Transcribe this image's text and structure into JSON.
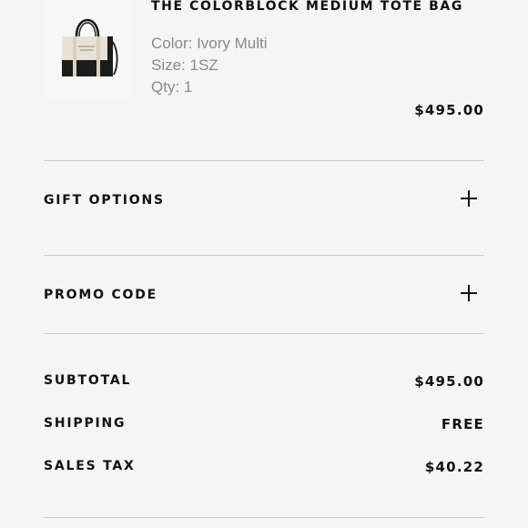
{
  "line_item": {
    "title": "THE COLORBLOCK MEDIUM TOTE BAG",
    "color": "Color: Ivory Multi",
    "size": "Size: 1SZ",
    "qty": "Qty: 1",
    "price": "$495.00",
    "image_icon": "tote-bag-image"
  },
  "accordions": {
    "gift_options": {
      "label": "GIFT OPTIONS",
      "icon": "plus-icon"
    },
    "promo_code": {
      "label": "PROMO CODE",
      "icon": "plus-icon"
    }
  },
  "summary": {
    "subtotal": {
      "label": "SUBTOTAL",
      "value": "$495.00"
    },
    "shipping": {
      "label": "SHIPPING",
      "value": "FREE"
    },
    "sales_tax": {
      "label": "SALES TAX",
      "value": "$40.22"
    }
  },
  "colors": {
    "background": "#f5f5f5",
    "text": "#111111",
    "muted_text": "#8a8a8a",
    "divider": "#c8c8c8"
  }
}
